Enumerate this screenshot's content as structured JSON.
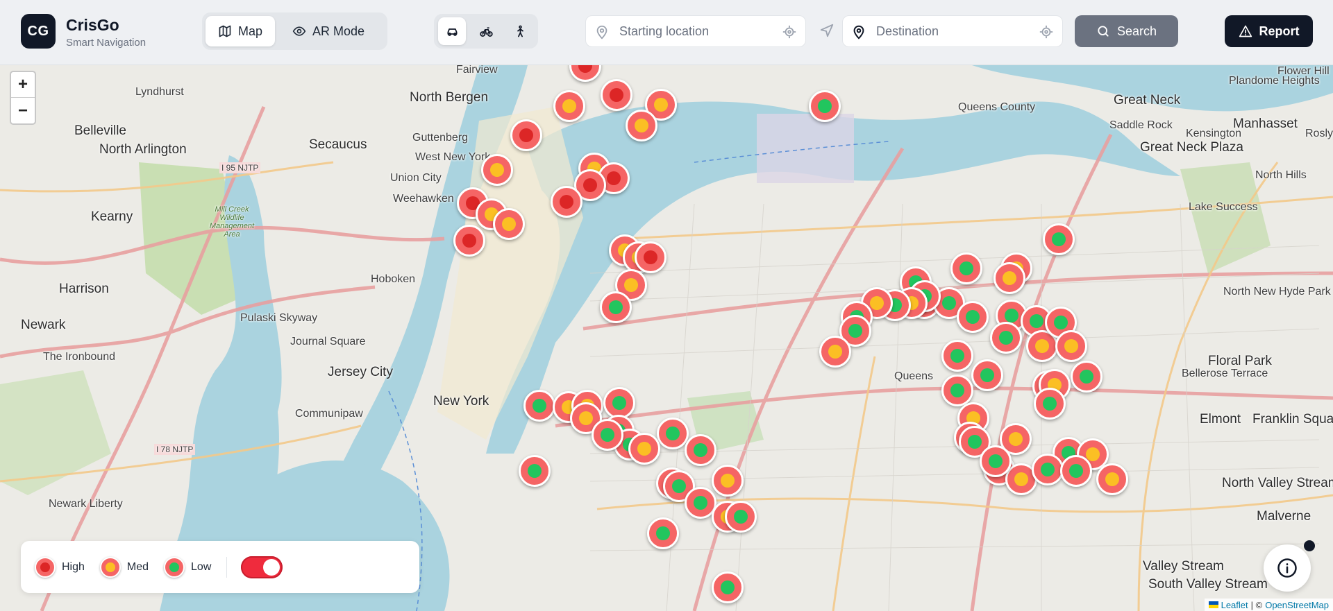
{
  "app": {
    "logo_text": "CG",
    "name": "CrisGo",
    "tagline": "Smart Navigation"
  },
  "modes": {
    "map_label": "Map",
    "ar_label": "AR Mode",
    "active": "Map"
  },
  "travel_modes": {
    "active": "car",
    "items": [
      "car",
      "bicycle",
      "walk"
    ]
  },
  "route": {
    "start_placeholder": "Starting location",
    "start_value": "",
    "destination_placeholder": "Destination",
    "destination_value": ""
  },
  "buttons": {
    "search": "Search",
    "report": "Report"
  },
  "map": {
    "zoom_in": "+",
    "zoom_out": "−",
    "labels": {
      "lyndhurst": "Lyndhurst",
      "north_bergen": "North Bergen",
      "fairview": "Fairview",
      "belleville": "Belleville",
      "north_arlington": "North Arlington",
      "secaucus": "Secaucus",
      "guttenberg": "Guttenberg",
      "west_new_york": "West New York",
      "union_city": "Union City",
      "weehawken": "Weehawken",
      "kearny": "Kearny",
      "harrison": "Harrison",
      "hoboken": "Hoboken",
      "newark": "Newark",
      "jersey_city": "Jersey City",
      "new_york": "New York",
      "queens": "Queens",
      "great_neck": "Great Neck",
      "manhasset": "Manhasset",
      "floral_park": "Floral Park",
      "elmont": "Elmont",
      "franklin_square": "Franklin Square",
      "north_valley_stream": "North Valley Stream",
      "valley_stream": "Valley Stream",
      "south_valley_stream": "South Valley Stream",
      "malverne": "Malverne",
      "north_new_hyde_park": "North New Hyde Park",
      "bellerose_terrace": "Bellerose Terrace",
      "lake_success": "Lake Success",
      "great_neck_plaza": "Great Neck Plaza",
      "queens_county": "Queens County",
      "communipaw": "Communipaw",
      "journal_square": "Journal Square",
      "pulaski_skyway": "Pulaski Skyway",
      "the_ironbound": "The Ironbound",
      "newark_liberty": "Newark Liberty",
      "flower_hill": "Flower Hill",
      "plandome_heights": "Plandome Heights",
      "saddle_rock": "Saddle Rock",
      "kensington": "Kensington",
      "north_hills": "North Hills",
      "roslyn": "Roslyn",
      "i95": "I 95 NJTP",
      "i78": "I 78 NJTP",
      "mill_creek": "Mill Creek Wildlife Management Area"
    },
    "incidents": [
      {
        "severity": "high"
      },
      {
        "severity": "med"
      },
      {
        "severity": "high"
      },
      {
        "severity": "med"
      },
      {
        "severity": "med"
      },
      {
        "severity": "high"
      },
      {
        "severity": "med"
      },
      {
        "severity": "med"
      },
      {
        "severity": "high"
      },
      {
        "severity": "high"
      },
      {
        "severity": "high"
      },
      {
        "severity": "med"
      },
      {
        "severity": "med"
      },
      {
        "severity": "high"
      },
      {
        "severity": "high"
      },
      {
        "severity": "med"
      },
      {
        "severity": "med"
      },
      {
        "severity": "high"
      },
      {
        "severity": "med"
      },
      {
        "severity": "low"
      },
      {
        "severity": "low"
      },
      {
        "severity": "med"
      },
      {
        "severity": "med"
      },
      {
        "severity": "low"
      },
      {
        "severity": "med"
      },
      {
        "severity": "low"
      },
      {
        "severity": "low"
      },
      {
        "severity": "low"
      },
      {
        "severity": "low"
      },
      {
        "severity": "low"
      },
      {
        "severity": "low"
      },
      {
        "severity": "med"
      },
      {
        "severity": "low"
      },
      {
        "severity": "med"
      },
      {
        "severity": "low"
      },
      {
        "severity": "low"
      },
      {
        "severity": "med"
      },
      {
        "severity": "low"
      },
      {
        "severity": "low"
      },
      {
        "severity": "low"
      },
      {
        "severity": "low"
      },
      {
        "severity": "low"
      },
      {
        "severity": "low"
      },
      {
        "severity": "low"
      },
      {
        "severity": "low"
      },
      {
        "severity": "low"
      },
      {
        "severity": "med"
      },
      {
        "severity": "low"
      },
      {
        "severity": "low"
      },
      {
        "severity": "low"
      },
      {
        "severity": "low"
      },
      {
        "severity": "med"
      },
      {
        "severity": "low"
      },
      {
        "severity": "low"
      },
      {
        "severity": "med"
      },
      {
        "severity": "med"
      },
      {
        "severity": "low"
      },
      {
        "severity": "low"
      },
      {
        "severity": "med"
      },
      {
        "severity": "med"
      },
      {
        "severity": "low"
      },
      {
        "severity": "med"
      },
      {
        "severity": "low"
      },
      {
        "severity": "med"
      },
      {
        "severity": "low"
      },
      {
        "severity": "med"
      },
      {
        "severity": "low"
      },
      {
        "severity": "low"
      },
      {
        "severity": "med"
      },
      {
        "severity": "low"
      },
      {
        "severity": "low"
      },
      {
        "severity": "low"
      },
      {
        "severity": "low"
      },
      {
        "severity": "low"
      },
      {
        "severity": "med"
      },
      {
        "severity": "med"
      },
      {
        "severity": "low"
      },
      {
        "severity": "med"
      },
      {
        "severity": "low"
      },
      {
        "severity": "low"
      },
      {
        "severity": "med"
      }
    ]
  },
  "legend": {
    "high": "High",
    "med": "Med",
    "low": "Low",
    "heatmap_toggle_on": true
  },
  "attribution": {
    "leaflet": "Leaflet",
    "separator": "| ©",
    "osm": "OpenStreetMap"
  },
  "colors": {
    "marker_ring": "#f56565",
    "high": "#dc2626",
    "med": "#fbbf24",
    "low": "#22c55e",
    "toggle": "#ef2b3d",
    "primary_dark": "#111827",
    "search_button": "#6b7280"
  }
}
